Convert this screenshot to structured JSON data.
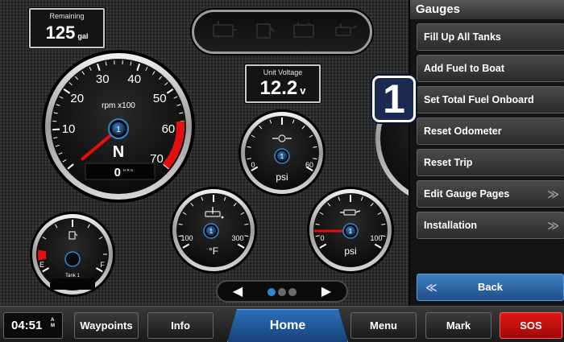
{
  "colors": {
    "accent_blue": "#2f87d6",
    "sos_red": "#d01010",
    "needle_red": "#e01010",
    "warning_zone": "#e01010"
  },
  "remaining": {
    "label": "Remaining",
    "value": "125",
    "unit": "gal"
  },
  "voltage": {
    "label": "Unit Voltage",
    "value": "12.2",
    "unit": "v"
  },
  "warning_icons": [
    "engine-icon",
    "fuel-can-icon",
    "battery-icon",
    "oil-can-icon"
  ],
  "tach": {
    "tick_labels": [
      "10",
      "20",
      "30",
      "40",
      "50",
      "60",
      "70"
    ],
    "units": "rpm x100",
    "gear": "N",
    "badge": "1",
    "hours_value": "0",
    "hours_unit": "H R S",
    "value_x100": 0,
    "min": 0,
    "max": 70
  },
  "pressure_top": {
    "min_label": "0",
    "max_label": "60",
    "unit": "psi",
    "badge": "1",
    "icon": "turbo-icon"
  },
  "temp": {
    "min_label": "100",
    "max_label": "300",
    "unit": "°F",
    "badge": "1",
    "icon": "oil-temp-icon"
  },
  "pressure_oil": {
    "min_label": "0",
    "max_label": "100",
    "unit": "psi",
    "badge": "1",
    "icon": "oil-pressure-icon",
    "value": 0
  },
  "fuel": {
    "empty_label": "E",
    "full_label": "F",
    "name": "Tank 1",
    "icon": "fuel-pump-icon",
    "level_fraction": 0.05
  },
  "panel": {
    "title": "Gauges",
    "items": [
      {
        "label": "Fill Up All Tanks",
        "more": ""
      },
      {
        "label": "Add Fuel to Boat",
        "more": ""
      },
      {
        "label": "Set Total Fuel Onboard",
        "more": ""
      },
      {
        "label": "Reset Odometer",
        "more": ""
      },
      {
        "label": "Reset Trip",
        "more": ""
      },
      {
        "label": "Edit Gauge Pages",
        "more": "≫"
      },
      {
        "label": "Installation",
        "more": "≫"
      }
    ],
    "back_label": "Back",
    "back_chevron": "≪"
  },
  "callout": "1",
  "pager": {
    "prev": "◀",
    "next": "▶",
    "pages": 3,
    "active": 0
  },
  "bottom": {
    "time": "04:51",
    "am": "A",
    "m": "M",
    "waypoints": "Waypoints",
    "info": "Info",
    "home": "Home",
    "menu": "Menu",
    "mark": "Mark",
    "sos": "SOS"
  }
}
